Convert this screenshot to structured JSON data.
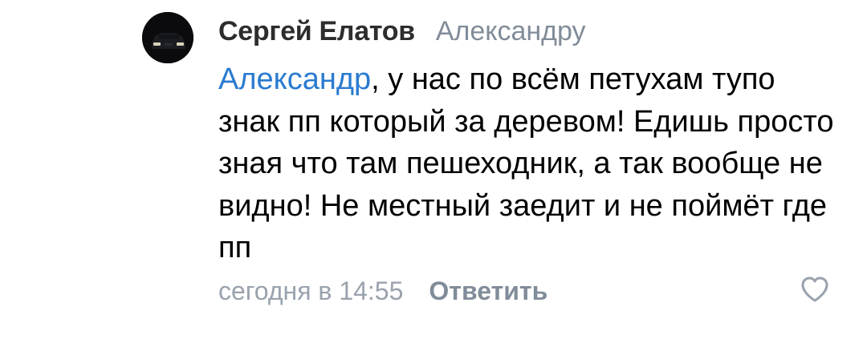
{
  "comment": {
    "author": "Сергей Елатов",
    "reply_to": "Александру",
    "mention": "Александр",
    "text": ", у нас по всём петухам тупо знак пп который за деревом! Едишь просто зная что там пешеходник, а так вообще не видно! Не местный заедит и не поймёт где пп",
    "timestamp": "сегодня в 14:55",
    "reply_label": "Ответить",
    "like_icon": "heart-outline-icon"
  },
  "colors": {
    "mention": "#2a7bd0",
    "meta": "#818c99",
    "author": "#2c2d2e"
  }
}
